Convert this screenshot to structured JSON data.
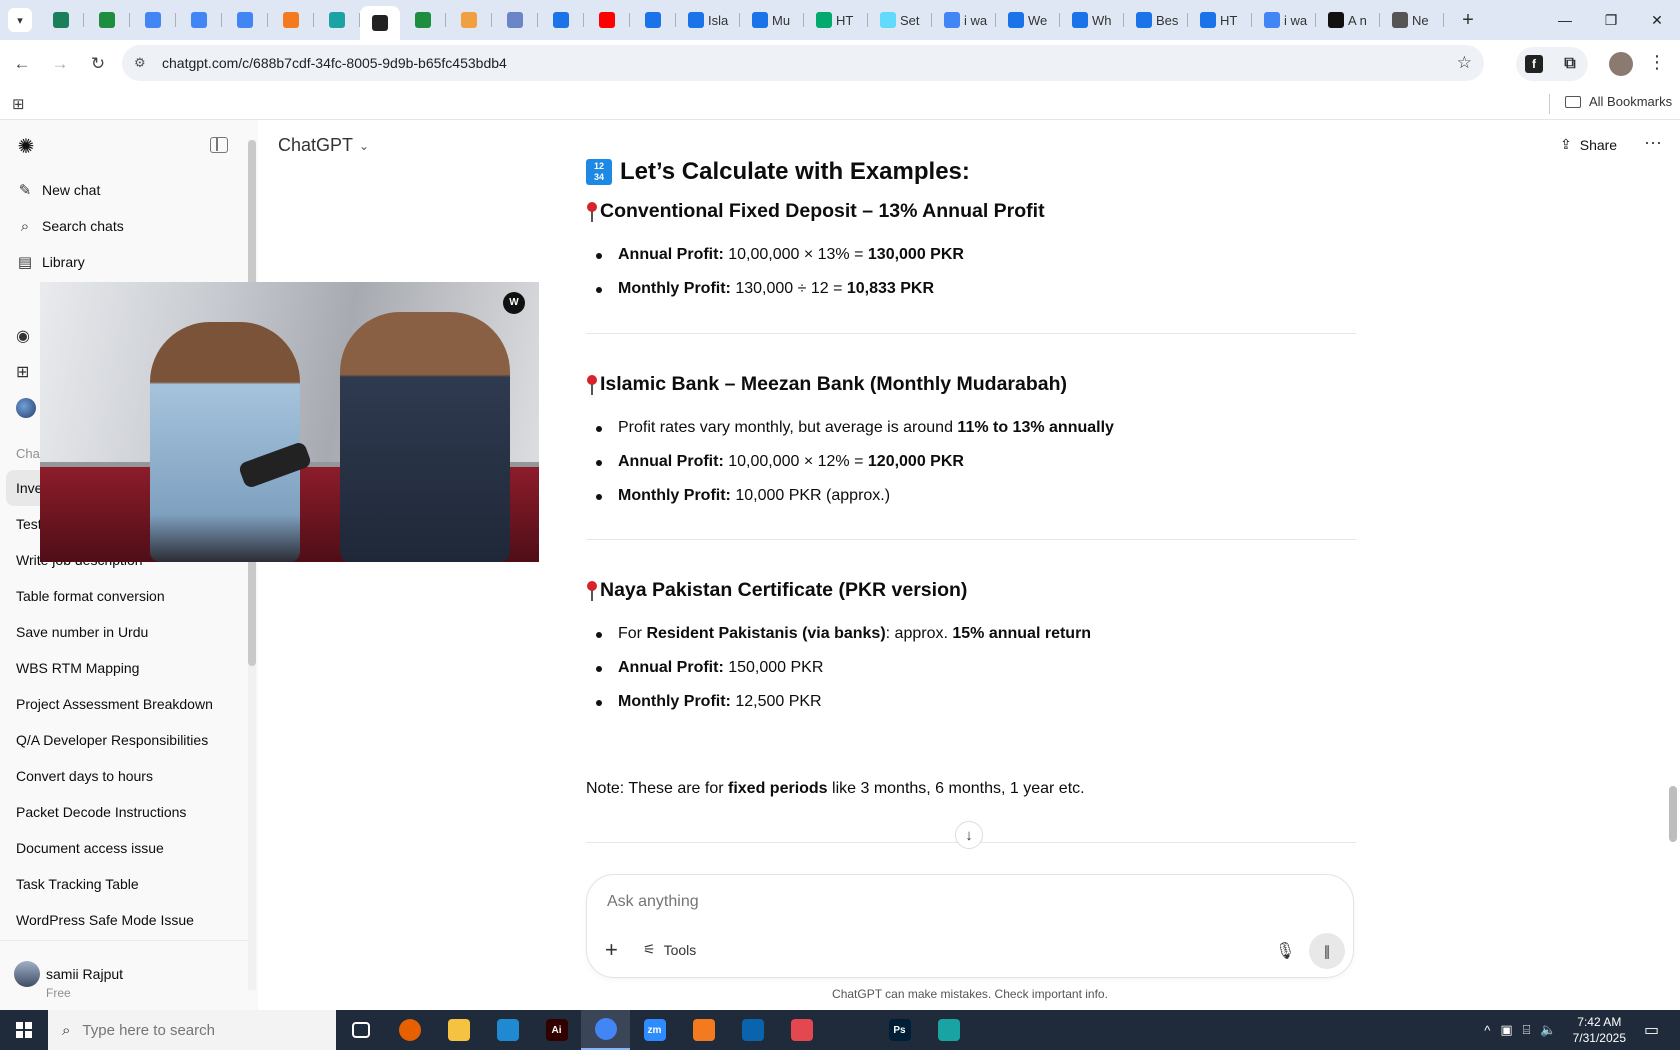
{
  "browser": {
    "tabs": [
      {
        "label": "",
        "icon": "vpn-icon",
        "color": "#1a7f5a"
      },
      {
        "label": "",
        "icon": "sheets-icon",
        "color": "#1e8e3e"
      },
      {
        "label": "",
        "icon": "docs-icon",
        "color": "#4285f4"
      },
      {
        "label": "",
        "icon": "docs-icon",
        "color": "#4285f4"
      },
      {
        "label": "",
        "icon": "docs-icon",
        "color": "#4285f4"
      },
      {
        "label": "",
        "icon": "xampp-icon",
        "color": "#f47a20"
      },
      {
        "label": "",
        "icon": "teal-icon",
        "color": "#1aa3a3"
      },
      {
        "label": "",
        "icon": "chatgpt-icon",
        "color": "#222222",
        "active": true
      },
      {
        "label": "",
        "icon": "sheets-icon",
        "color": "#1e8e3e"
      },
      {
        "label": "",
        "icon": "hand-icon",
        "color": "#f0a040"
      },
      {
        "label": "",
        "icon": "grid-icon",
        "color": "#6a86c7"
      },
      {
        "label": "",
        "icon": "forms-icon",
        "color": "#1a73e8"
      },
      {
        "label": "",
        "icon": "youtube-icon",
        "color": "#ff0000"
      },
      {
        "label": "",
        "icon": "forms-icon",
        "color": "#1a73e8"
      },
      {
        "label": "Isla",
        "icon": "forms-icon",
        "color": "#1a73e8"
      },
      {
        "label": "Mu",
        "icon": "forms-icon",
        "color": "#1a73e8"
      },
      {
        "label": "HT",
        "icon": "w3-icon",
        "color": "#04aa6d"
      },
      {
        "label": "Set",
        "icon": "react-icon",
        "color": "#61dafb"
      },
      {
        "label": "i wa",
        "icon": "google-icon",
        "color": "#4285f4"
      },
      {
        "label": "We",
        "icon": "c-icon",
        "color": "#1a73e8"
      },
      {
        "label": "Wh",
        "icon": "c-icon",
        "color": "#1a73e8"
      },
      {
        "label": "Bes",
        "icon": "c-icon",
        "color": "#1a73e8"
      },
      {
        "label": "HT",
        "icon": "c-icon",
        "color": "#1a73e8"
      },
      {
        "label": "i wa",
        "icon": "google-icon",
        "color": "#4285f4"
      },
      {
        "label": "A n",
        "icon": "a-icon",
        "color": "#111111"
      },
      {
        "label": "Ne",
        "icon": "chrome-icon",
        "color": "#555555"
      }
    ],
    "url": "chatgpt.com/c/688b7cdf-34fc-8005-9d9b-b65fc453bdb4",
    "all_bookmarks": "All Bookmarks"
  },
  "sidebar": {
    "top": [
      {
        "label": "New chat",
        "icon": "edit-icon"
      },
      {
        "label": "Search chats",
        "icon": "search-icon"
      },
      {
        "label": "Library",
        "icon": "library-icon"
      }
    ],
    "section_label": "Cha",
    "chats": [
      {
        "label": "Inve",
        "active": true
      },
      {
        "label": "Test"
      },
      {
        "label": "Write job description"
      },
      {
        "label": "Table format conversion"
      },
      {
        "label": "Save number in Urdu"
      },
      {
        "label": "WBS RTM Mapping"
      },
      {
        "label": "Project Assessment Breakdown"
      },
      {
        "label": "Q/A Developer Responsibilities"
      },
      {
        "label": "Convert days to hours"
      },
      {
        "label": "Packet Decode Instructions"
      },
      {
        "label": "Document access issue"
      },
      {
        "label": "Task Tracking Table"
      },
      {
        "label": "WordPress Safe Mode Issue"
      }
    ],
    "user": {
      "name": "samii Rajput",
      "plan": "Free"
    }
  },
  "header": {
    "model": "ChatGPT",
    "share": "Share"
  },
  "content": {
    "heading": "Let’s Calculate with Examples:",
    "sections": [
      {
        "title": "Conventional Fixed Deposit – 13% Annual Profit",
        "items": [
          {
            "bold": "Annual Profit:",
            "text": " 10,00,000 × 13% = ",
            "bold2": "130,000 PKR",
            "text2": ""
          },
          {
            "bold": "Monthly Profit:",
            "text": " 130,000 ÷ 12 = ",
            "bold2": "10,833 PKR",
            "text2": ""
          }
        ]
      },
      {
        "title": "Islamic Bank – Meezan Bank (Monthly Mudarabah)",
        "items": [
          {
            "bold": "",
            "text": "Profit rates vary monthly, but average is around ",
            "bold2": "11% to 13% annually",
            "text2": ""
          },
          {
            "bold": "Annual Profit:",
            "text": " 10,00,000 × 12% = ",
            "bold2": "120,000 PKR",
            "text2": ""
          },
          {
            "bold": "Monthly Profit:",
            "text": " 10,000 PKR (approx.)",
            "bold2": "",
            "text2": ""
          }
        ]
      },
      {
        "title": "Naya Pakistan Certificate (PKR version)",
        "items": [
          {
            "bold": "",
            "text": "For ",
            "bold2": "Resident Pakistanis (via banks)",
            "text2": ": approx. ",
            "bold3": "15% annual return"
          },
          {
            "bold": "Annual Profit:",
            "text": " 150,000 PKR",
            "bold2": "",
            "text2": ""
          },
          {
            "bold": "Monthly Profit:",
            "text": " 12,500 PKR",
            "bold2": "",
            "text2": ""
          }
        ]
      }
    ],
    "note": {
      "prefix": "Note: These are for ",
      "bold": "fixed periods",
      "suffix": " like 3 months, 6 months, 1 year etc."
    }
  },
  "composer": {
    "placeholder": "Ask anything",
    "tools": "Tools"
  },
  "disclaimer": "ChatGPT can make mistakes. Check important info.",
  "taskbar": {
    "search_placeholder": "Type here to search",
    "apps": [
      {
        "icon": "task-view-icon",
        "color": "#1f2a3a",
        "label": ""
      },
      {
        "icon": "firefox-icon",
        "color": "#e66000",
        "label": ""
      },
      {
        "icon": "file-explorer-icon",
        "color": "#f5c242",
        "label": ""
      },
      {
        "icon": "vscode-icon",
        "color": "#1f8ad2",
        "label": ""
      },
      {
        "icon": "illustrator-icon",
        "color": "#330000",
        "label": "Ai"
      },
      {
        "icon": "chrome-icon",
        "color": "#4285f4",
        "label": "",
        "active": true
      },
      {
        "icon": "zoom-icon",
        "color": "#2d8cff",
        "label": "zm"
      },
      {
        "icon": "xampp-icon",
        "color": "#f47a20",
        "label": ""
      },
      {
        "icon": "outlook-icon",
        "color": "#0a64ad",
        "label": ""
      },
      {
        "icon": "creative-cloud-icon",
        "color": "#e34850",
        "label": ""
      },
      {
        "icon": "pen-icon",
        "color": "#1f2a3a",
        "label": ""
      },
      {
        "icon": "photoshop-icon",
        "color": "#001e36",
        "label": "Ps"
      },
      {
        "icon": "teal-app-icon",
        "color": "#1aa3a3",
        "label": ""
      }
    ],
    "time": "7:42 AM",
    "date": "7/31/2025"
  }
}
